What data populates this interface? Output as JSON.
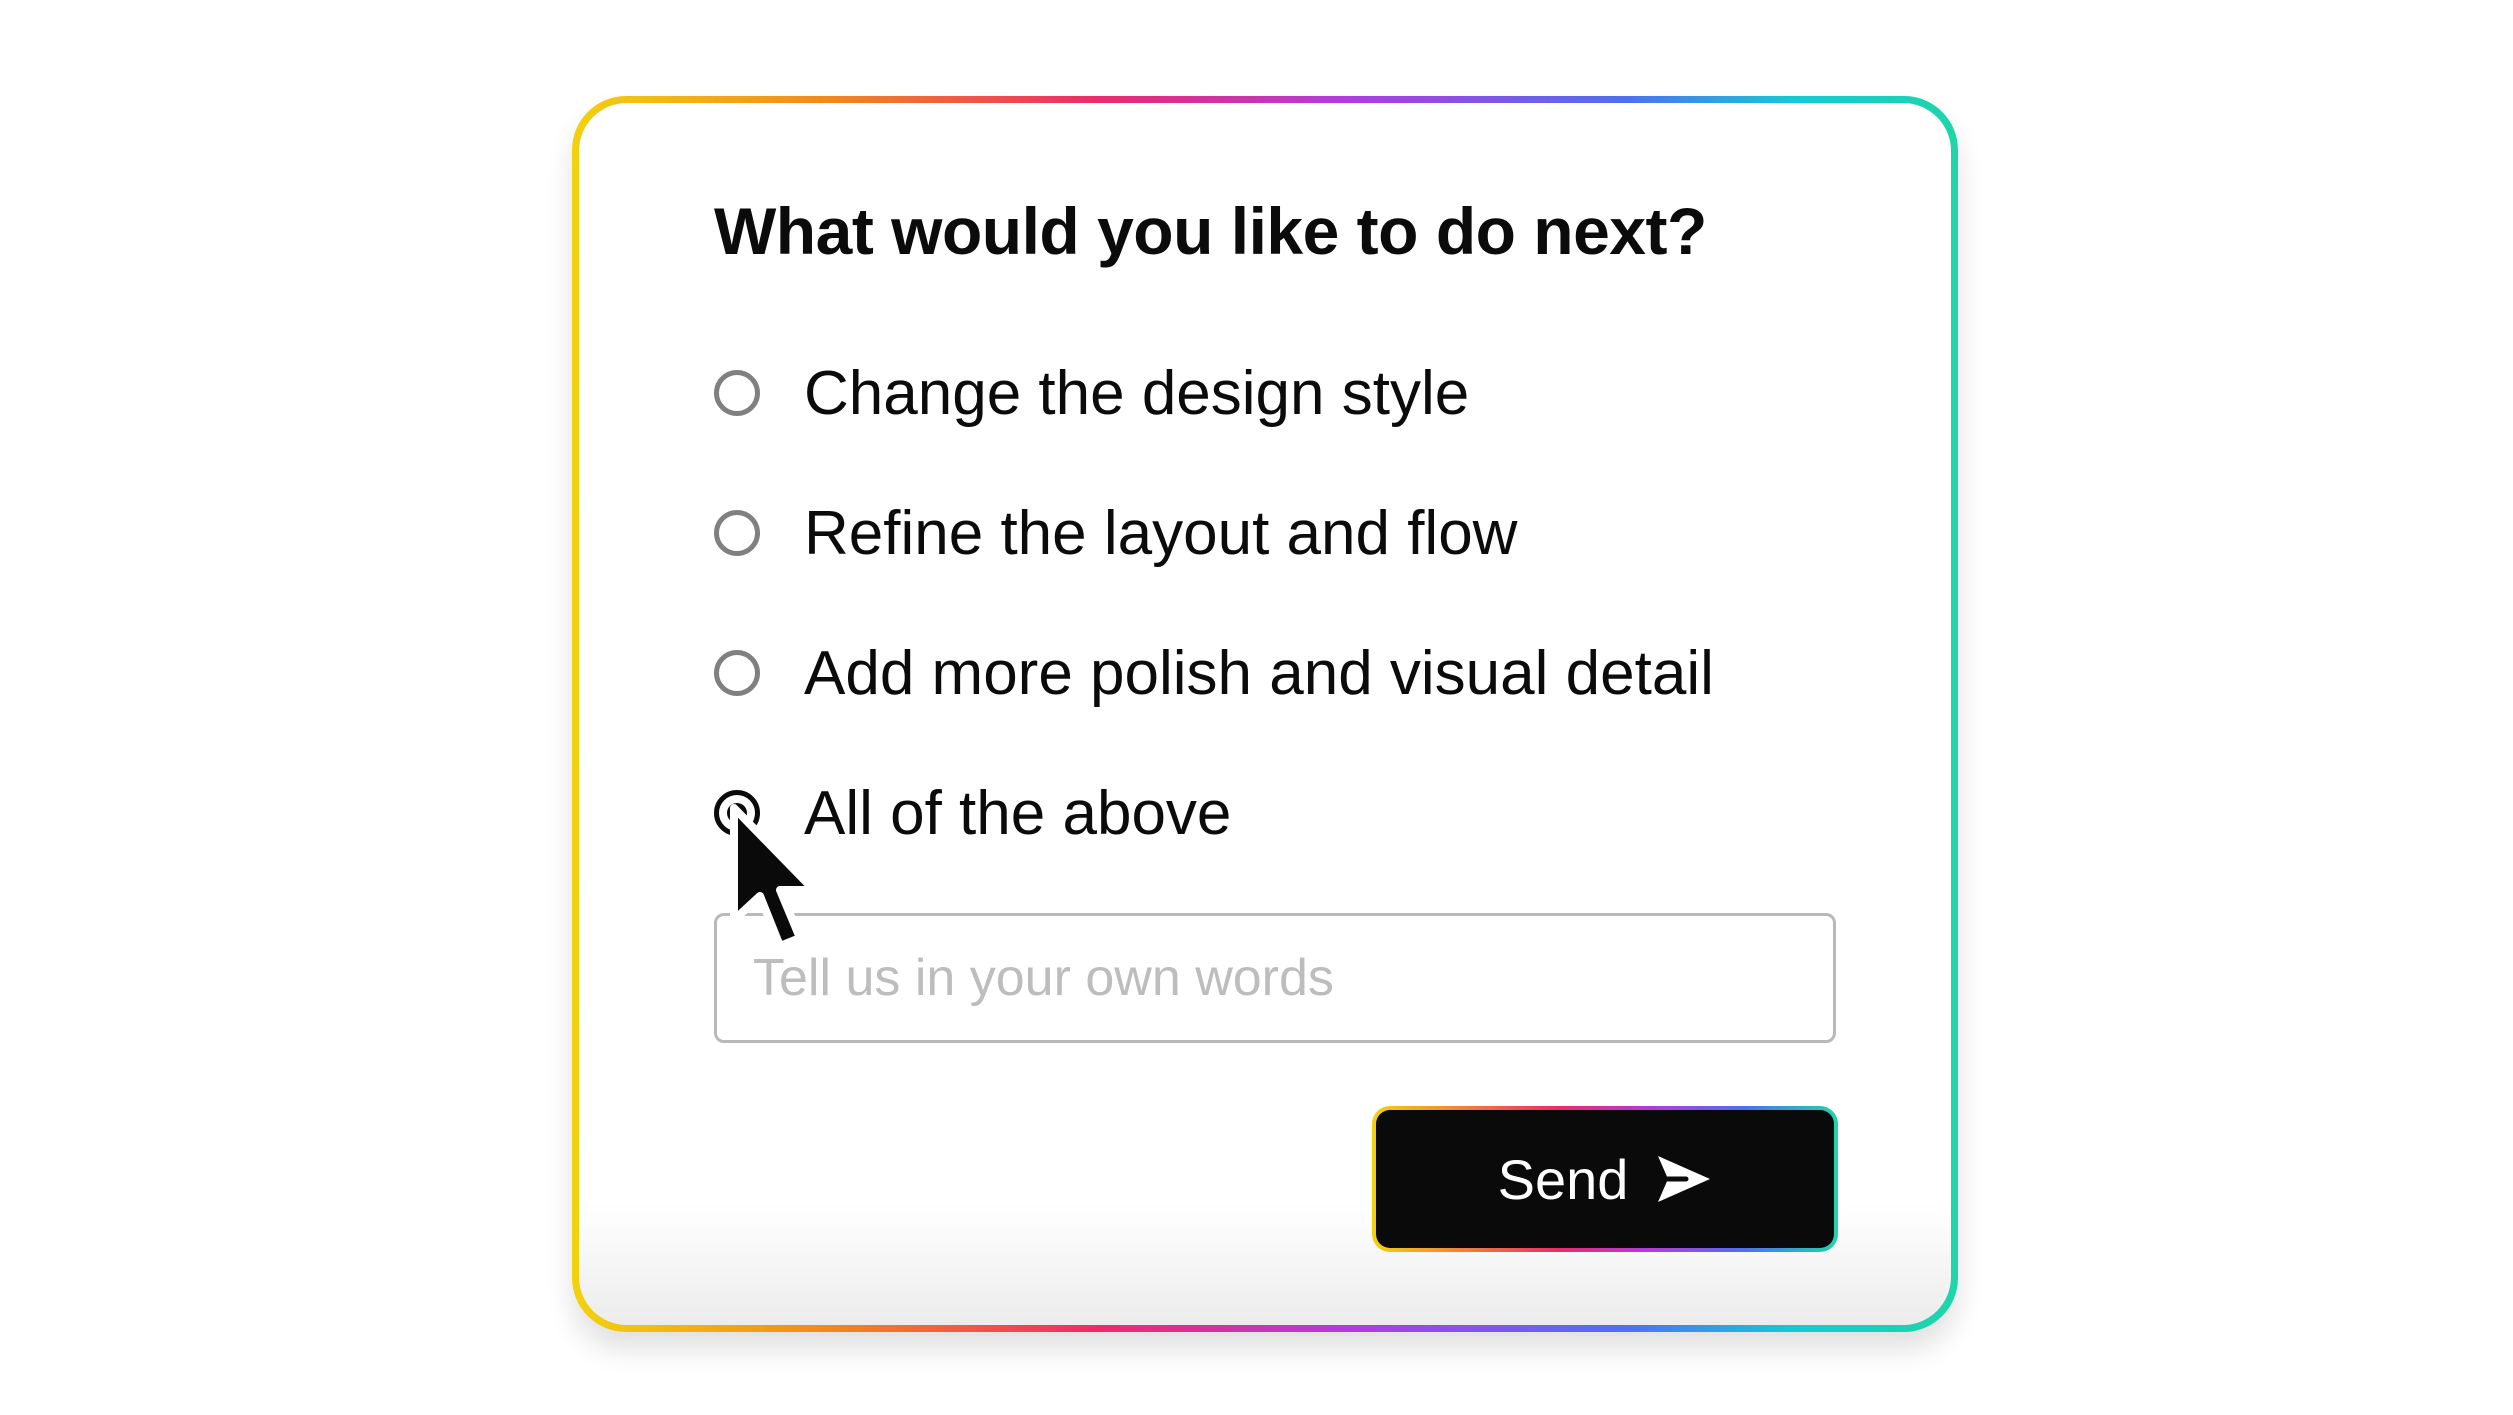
{
  "prompt": {
    "question": "What would you like to do next?",
    "options": [
      {
        "label": "Change the design style",
        "selected": false
      },
      {
        "label": "Refine the layout and flow",
        "selected": false
      },
      {
        "label": "Add more polish and visual detail",
        "selected": false
      },
      {
        "label": "All of the above",
        "selected": true
      }
    ],
    "input_placeholder": "Tell us in your own words",
    "input_value": "",
    "send_label": "Send",
    "send_icon": "send-arrow-icon"
  },
  "colors": {
    "border_gradient": [
      "#f2d20f",
      "#f28a1a",
      "#ee2a6b",
      "#b23be0",
      "#4f6ff2",
      "#15c8d6",
      "#1fd6a8"
    ],
    "button_bg": "#0a0a0a",
    "text": "#0b0b0b",
    "radio_unselected": "#808080"
  }
}
